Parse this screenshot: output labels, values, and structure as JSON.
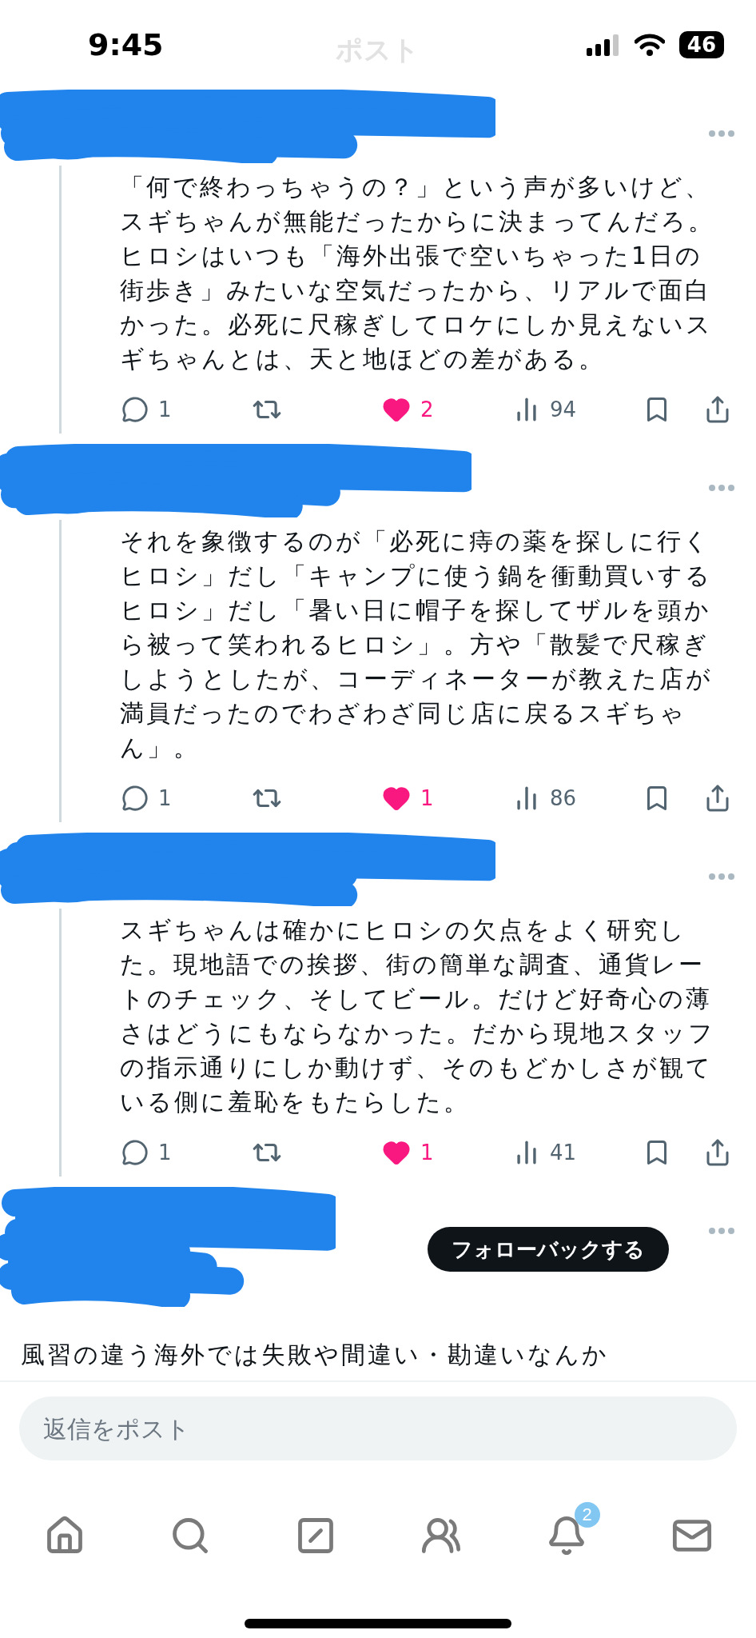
{
  "status_bar": {
    "time": "9:45",
    "battery": "46"
  },
  "header": {
    "title": "ポスト"
  },
  "posts": [
    {
      "kind": "reply",
      "text_lines": [
        "「何で終わっちゃうの？」という声が多いけど、",
        "スギちゃんが無能だったからに決まってんだろ。",
        "ヒロシはいつも「海外出張で空いちゃった1日の",
        "街歩き」みたいな空気だったから、リアルで面白",
        "かった。必死に尺稼ぎしてロケにしか見えないス",
        "ギちゃんとは、天と地ほどの差がある。"
      ],
      "actions": {
        "replies": "1",
        "likes": "2",
        "liked": true,
        "views": "94"
      }
    },
    {
      "kind": "reply",
      "text_lines": [
        "それを象徴するのが「必死に痔の薬を探しに行く",
        "ヒロシ」だし「キャンプに使う鍋を衝動買いする",
        "ヒロシ」だし「暑い日に帽子を探してザルを頭か",
        "ら被って笑われるヒロシ」。方や「散髪で尺稼ぎ",
        "しようとしたが、コーディネーターが教えた店が",
        "満員だったのでわざわざ同じ店に戻るスギちゃ",
        "ん」。"
      ],
      "actions": {
        "replies": "1",
        "likes": "1",
        "liked": true,
        "views": "86"
      }
    },
    {
      "kind": "reply",
      "text_lines": [
        "スギちゃんは確かにヒロシの欠点をよく研究し",
        "た。現地語での挨拶、街の簡単な調査、通貨レー",
        "トのチェック、そしてビール。だけど好奇心の薄",
        "さはどうにもならなかった。だから現地スタッフ",
        "の指示通りにしか動けず、そのもどかしさが観て",
        "いる側に羞恥をもたらした。"
      ],
      "actions": {
        "replies": "1",
        "likes": "1",
        "liked": true,
        "views": "41"
      }
    },
    {
      "kind": "main",
      "follow_button": "フォローバックする",
      "text_lines": [
        "風習の違う海外では失敗や間違い・勘違いなんか"
      ]
    }
  ],
  "reply_field": {
    "placeholder": "返信をポスト"
  },
  "tab_bar": {
    "items": [
      {
        "kind": "home"
      },
      {
        "kind": "search"
      },
      {
        "kind": "compose"
      },
      {
        "kind": "communities"
      },
      {
        "kind": "notifications",
        "badge": "2"
      },
      {
        "kind": "messages"
      }
    ]
  }
}
